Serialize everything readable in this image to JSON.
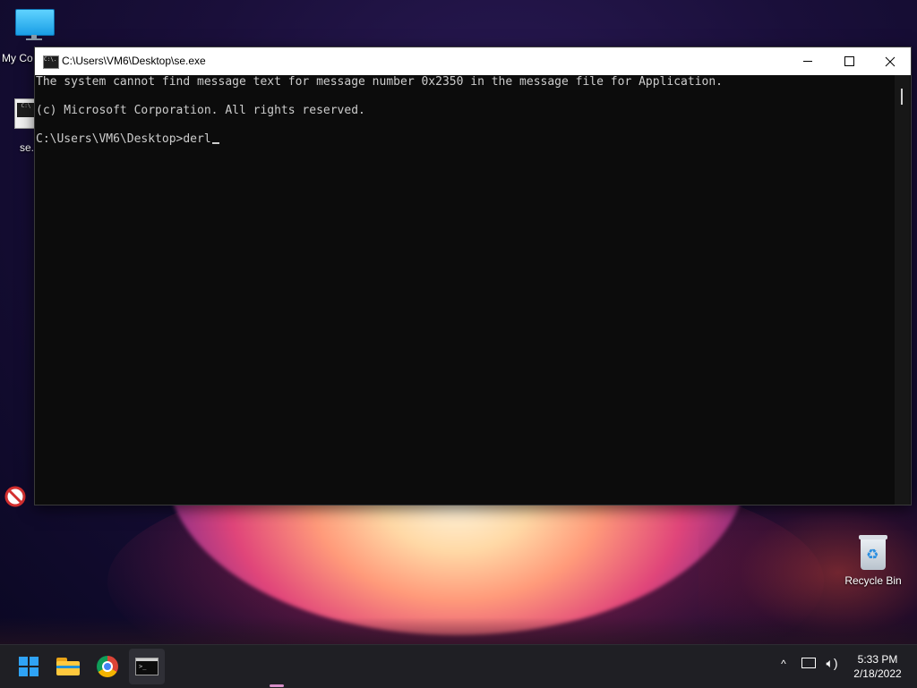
{
  "desktop": {
    "icons": [
      {
        "label": "My Co"
      },
      {
        "label": "se."
      },
      {
        "label": "Recycle Bin"
      }
    ]
  },
  "window": {
    "title": "C:\\Users\\VM6\\Desktop\\se.exe",
    "icon_text": "C:\\.",
    "console_lines": [
      "The system cannot find message text for message number 0x2350 in the message file for Application.",
      "(c) Microsoft Corporation. All rights reserved.",
      "C:\\Users\\VM6\\Desktop>derl"
    ],
    "console_colors": {
      "background": "#0c0c0c",
      "text": "#cccccc"
    }
  },
  "taskbar": {
    "apps": [
      {
        "icon": "windows-start-icon"
      },
      {
        "icon": "file-explorer-icon"
      },
      {
        "icon": "chrome-icon"
      },
      {
        "icon": "terminal-icon",
        "active": true
      }
    ],
    "tray": {
      "chevron_glyph": "^",
      "volume_glyph": "🔈︎)"
    },
    "clock": {
      "time": "5:33 PM",
      "date": "2/18/2022"
    }
  },
  "colors": {
    "taskbar": "#1f1f24",
    "accent": "#2fa3f7",
    "active_indicator": "#d98fc8"
  }
}
